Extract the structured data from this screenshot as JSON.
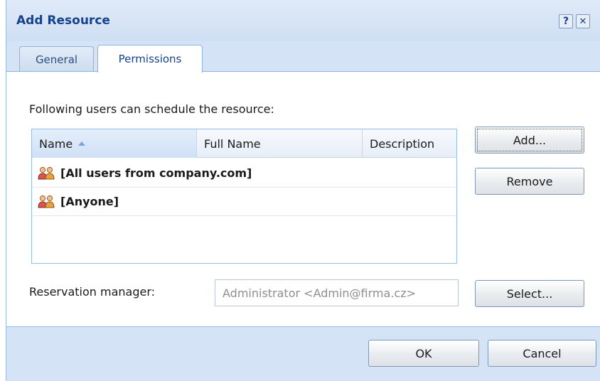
{
  "dialog": {
    "title": "Add Resource",
    "help_glyph": "?",
    "close_glyph": "✕"
  },
  "tabs": [
    {
      "label": "General",
      "active": false
    },
    {
      "label": "Permissions",
      "active": true
    }
  ],
  "permissions": {
    "intro": "Following users can schedule the resource:",
    "columns": {
      "name": "Name",
      "full_name": "Full Name",
      "description": "Description"
    },
    "sort": {
      "column": "name",
      "direction": "ascending"
    },
    "rows": [
      {
        "name": "[All users from company.com]",
        "icon": "user-group-icon"
      },
      {
        "name": "[Anyone]",
        "icon": "user-group-icon"
      }
    ],
    "add_label": "Add...",
    "remove_label": "Remove",
    "reservation_label": "Reservation manager:",
    "reservation_value": "Administrator <Admin@firma.cz>",
    "select_label": "Select..."
  },
  "footer": {
    "ok_label": "OK",
    "cancel_label": "Cancel"
  },
  "colors": {
    "accent": "#15428b",
    "frame": "#d4e3f5",
    "border": "#99bbe8"
  }
}
